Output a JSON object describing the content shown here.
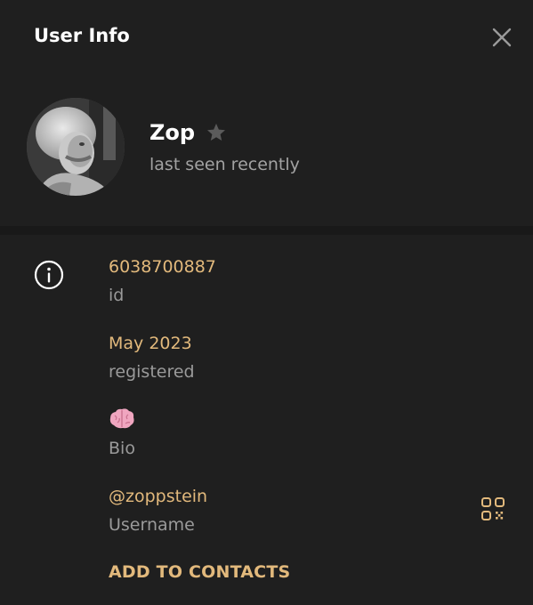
{
  "header": {
    "title": "User Info",
    "close_icon": "close-icon"
  },
  "profile": {
    "name": "Zop",
    "status": "last seen recently",
    "star_icon": "star-icon",
    "avatar": "avatar-photo"
  },
  "info": {
    "icon": "info-icon",
    "id_value": "6038700887",
    "id_label": "id",
    "registered_value": "May 2023",
    "registered_label": "registered",
    "bio_value_icon": "brain-emoji-icon",
    "bio_label": "Bio",
    "username_value": "@zoppstein",
    "username_label": "Username",
    "qr_icon": "qr-code-icon"
  },
  "actions": {
    "add_to_contacts": "ADD TO CONTACTS"
  },
  "colors": {
    "background": "#1f1f1f",
    "accent": "#e2b97c",
    "text_primary": "#ffffff",
    "text_secondary": "#9a9a9a"
  }
}
